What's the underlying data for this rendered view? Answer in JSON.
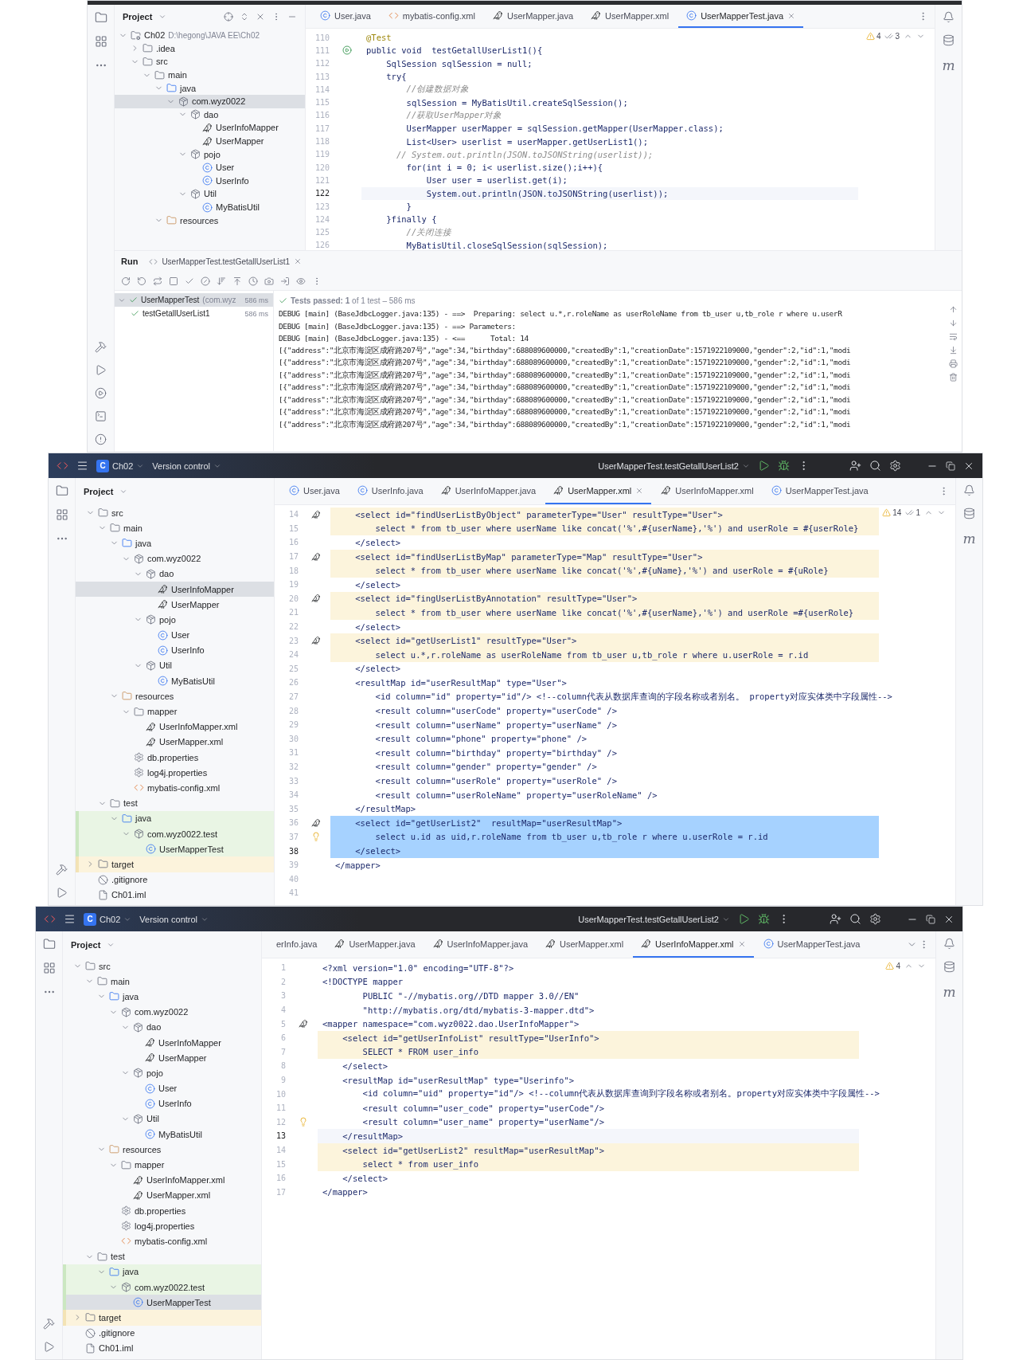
{
  "panels": [
    {
      "kind": "test-run",
      "tree_header": "Project",
      "tree": [
        {
          "label": "Ch02",
          "path": "D:\\hegong\\JAVA EE\\Ch02",
          "kind": "module",
          "expanded": true,
          "selected": false,
          "children": [
            {
              "label": ".idea",
              "kind": "folder",
              "expanded": false,
              "selected": false
            },
            {
              "label": "src",
              "kind": "folder",
              "expanded": true,
              "selected": false,
              "children": [
                {
                  "label": "main",
                  "kind": "folder",
                  "expanded": true,
                  "selected": false,
                  "children": [
                    {
                      "label": "java",
                      "kind": "source",
                      "expanded": true,
                      "selected": false,
                      "children": [
                        {
                          "label": "com.wyz0022",
                          "kind": "package",
                          "expanded": true,
                          "selected": true,
                          "children": [
                            {
                              "label": "dao",
                              "kind": "package",
                              "expanded": true,
                              "selected": false,
                              "children": [
                                {
                                  "label": "UserInfoMapper",
                                  "kind": "mapper",
                                  "selected": false
                                },
                                {
                                  "label": "UserMapper",
                                  "kind": "mapper",
                                  "selected": false
                                }
                              ]
                            },
                            {
                              "label": "pojo",
                              "kind": "package",
                              "expanded": true,
                              "selected": false,
                              "children": [
                                {
                                  "label": "User",
                                  "kind": "class",
                                  "selected": false
                                },
                                {
                                  "label": "UserInfo",
                                  "kind": "class",
                                  "selected": false
                                }
                              ]
                            },
                            {
                              "label": "Util",
                              "kind": "package",
                              "expanded": true,
                              "selected": false,
                              "children": [
                                {
                                  "label": "MyBatisUtil",
                                  "kind": "class",
                                  "selected": false
                                }
                              ]
                            }
                          ]
                        }
                      ]
                    },
                    {
                      "label": "resources",
                      "kind": "resources",
                      "expanded": true,
                      "selected": false
                    }
                  ]
                }
              ]
            }
          ]
        }
      ],
      "tabs": [
        {
          "label": "User.java",
          "kind": "class",
          "selected": false
        },
        {
          "label": "mybatis-config.xml",
          "kind": "xml",
          "selected": false
        },
        {
          "label": "UserMapper.java",
          "kind": "mapper",
          "selected": false
        },
        {
          "label": "UserMapper.xml",
          "kind": "mapper",
          "selected": false
        },
        {
          "label": "UserMapperTest.java",
          "kind": "class",
          "selected": true
        }
      ],
      "inspection": {
        "warnings": "4",
        "checks": "3"
      },
      "code": [
        {
          "n": "110",
          "text": "@Test",
          "kind": "annotation"
        },
        {
          "n": "111",
          "text": "public void  testGetallUserList1(){",
          "kind": "code",
          "gutter": {
            "kind": "run"
          }
        },
        {
          "n": "112",
          "text": "    SqlSession sqlSession = null;",
          "kind": "code"
        },
        {
          "n": "113",
          "text": "    try{",
          "kind": "code"
        },
        {
          "n": "114",
          "text": "        //创建数据对象",
          "kind": "comment"
        },
        {
          "n": "115",
          "text": "        sqlSession = MyBatisUtil.createSqlSession();",
          "kind": "code"
        },
        {
          "n": "116",
          "text": "        //获取UserMapper对象",
          "kind": "comment"
        },
        {
          "n": "117",
          "text": "        UserMapper userMapper = sqlSession.getMapper(UserMapper.class);",
          "kind": "code"
        },
        {
          "n": "118",
          "text": "        List<User> userlist = userMapper.getUserList1();",
          "kind": "code"
        },
        {
          "n": "119",
          "text": "      // System.out.println(JSON.toJSONString(userlist));",
          "kind": "comment"
        },
        {
          "n": "120",
          "text": "        for(int i = 0; i< userlist.size();i++){",
          "kind": "code"
        },
        {
          "n": "121",
          "text": "            User user = userlist.get(i);",
          "kind": "code"
        },
        {
          "n": "122",
          "text": "            System.out.println(JSON.toJSONString(userlist));",
          "kind": "code",
          "current": true
        },
        {
          "n": "123",
          "text": "        }",
          "kind": "code"
        },
        {
          "n": "124",
          "text": "    }finally {",
          "kind": "code"
        },
        {
          "n": "125",
          "text": "        //关闭连接",
          "kind": "comment"
        },
        {
          "n": "126",
          "text": "        MyBatisUtil.closeSqlSession(sqlSession);",
          "kind": "code"
        }
      ],
      "run": {
        "title": "Run",
        "tab": "UserMapperTest.testGetallUserList1",
        "tests": [
          {
            "label": "UserMapperTest",
            "detail": "(com.wyz",
            "time": "586 ms",
            "passed": true,
            "expanded": true
          },
          {
            "label": "testGetallUserList1",
            "time": "586 ms",
            "passed": true
          }
        ],
        "status": "**Tests passed: 1** of 1 test – 586 ms",
        "output": [
          "DEBUG [main] (BaseJdbcLogger.java:135) - ==>  Preparing: select u.*,r.roleName as userRoleName from tb_user u,tb_role r where u.userR",
          "DEBUG [main] (BaseJdbcLogger.java:135) - ==> Parameters: ",
          "DEBUG [main] (BaseJdbcLogger.java:135) - <==      Total: 14",
          "[{\"address\":\"北京市海淀区成府路207号\",\"age\":34,\"birthday\":688089600000,\"createdBy\":1,\"creationDate\":1571922109000,\"gender\":2,\"id\":1,\"modi",
          "[{\"address\":\"北京市海淀区成府路207号\",\"age\":34,\"birthday\":688089600000,\"createdBy\":1,\"creationDate\":1571922109000,\"gender\":2,\"id\":1,\"modi",
          "[{\"address\":\"北京市海淀区成府路207号\",\"age\":34,\"birthday\":688089600000,\"createdBy\":1,\"creationDate\":1571922109000,\"gender\":2,\"id\":1,\"modi",
          "[{\"address\":\"北京市海淀区成府路207号\",\"age\":34,\"birthday\":688089600000,\"createdBy\":1,\"creationDate\":1571922109000,\"gender\":2,\"id\":1,\"modi",
          "[{\"address\":\"北京市海淀区成府路207号\",\"age\":34,\"birthday\":688089600000,\"createdBy\":1,\"creationDate\":1571922109000,\"gender\":2,\"id\":1,\"modi",
          "[{\"address\":\"北京市海淀区成府路207号\",\"age\":34,\"birthday\":688089600000,\"createdBy\":1,\"creationDate\":1571922109000,\"gender\":2,\"id\":1,\"modi",
          "[{\"address\":\"北京市海淀区成府路207号\",\"age\":34,\"birthday\":688089600000,\"createdBy\":1,\"creationDate\":1571922109000,\"gender\":2,\"id\":1,\"modi"
        ]
      },
      "right_stripe_glyph": "m"
    },
    {
      "kind": "editor",
      "title_bar": {
        "project_badge": "C",
        "project": "Ch02",
        "vcs": "Version control",
        "run_config": "UserMapperTest.testGetallUserList2"
      },
      "tree_header": "Project",
      "tree": [
        {
          "label": "src",
          "kind": "folder",
          "expanded": true,
          "selected": false,
          "children": [
            {
              "label": "main",
              "kind": "folder",
              "expanded": true,
              "selected": false,
              "children": [
                {
                  "label": "java",
                  "kind": "source",
                  "expanded": true,
                  "selected": false,
                  "children": [
                    {
                      "label": "com.wyz0022",
                      "kind": "package",
                      "expanded": true,
                      "selected": false,
                      "children": [
                        {
                          "label": "dao",
                          "kind": "package",
                          "expanded": true,
                          "selected": false,
                          "children": [
                            {
                              "label": "UserInfoMapper",
                              "kind": "mapper",
                              "selected": true
                            },
                            {
                              "label": "UserMapper",
                              "kind": "mapper",
                              "selected": false
                            }
                          ]
                        },
                        {
                          "label": "pojo",
                          "kind": "package",
                          "expanded": true,
                          "selected": false,
                          "children": [
                            {
                              "label": "User",
                              "kind": "class",
                              "selected": false
                            },
                            {
                              "label": "UserInfo",
                              "kind": "class",
                              "selected": false
                            }
                          ]
                        },
                        {
                          "label": "Util",
                          "kind": "package",
                          "expanded": true,
                          "selected": false,
                          "children": [
                            {
                              "label": "MyBatisUtil",
                              "kind": "class",
                              "selected": false
                            }
                          ]
                        }
                      ]
                    }
                  ]
                },
                {
                  "label": "resources",
                  "kind": "resources",
                  "expanded": true,
                  "selected": false,
                  "children": [
                    {
                      "label": "mapper",
                      "kind": "folder",
                      "expanded": true,
                      "selected": false,
                      "children": [
                        {
                          "label": "UserInfoMapper.xml",
                          "kind": "mapper",
                          "selected": false
                        },
                        {
                          "label": "UserMapper.xml",
                          "kind": "mapper",
                          "selected": false
                        }
                      ]
                    },
                    {
                      "label": "db.properties",
                      "kind": "props",
                      "selected": false
                    },
                    {
                      "label": "log4j.properties",
                      "kind": "props",
                      "selected": false
                    },
                    {
                      "label": "mybatis-config.xml",
                      "kind": "xml",
                      "selected": false
                    }
                  ]
                }
              ]
            },
            {
              "label": "test",
              "kind": "folder",
              "expanded": true,
              "selected": false,
              "children": [
                {
                  "label": "java",
                  "kind": "source",
                  "expanded": true,
                  "selected": false,
                  "in_tests": true,
                  "children": [
                    {
                      "label": "com.wyz0022.test",
                      "kind": "package",
                      "expanded": true,
                      "selected": false,
                      "in_tests": true,
                      "children": [
                        {
                          "label": "UserMapperTest",
                          "kind": "class",
                          "selected": false,
                          "in_tests": true
                        }
                      ]
                    }
                  ]
                }
              ]
            }
          ]
        },
        {
          "label": "target",
          "kind": "folder",
          "expanded": false,
          "selected": false,
          "excluded": true
        },
        {
          "label": ".gitignore",
          "kind": "ignore",
          "selected": false
        },
        {
          "label": "Ch01.iml",
          "kind": "iml",
          "selected": false
        }
      ],
      "tabs": [
        {
          "label": "User.java",
          "kind": "class",
          "selected": false
        },
        {
          "label": "UserInfo.java",
          "kind": "class",
          "selected": false
        },
        {
          "label": "UserInfoMapper.java",
          "kind": "mapper",
          "selected": false
        },
        {
          "label": "UserMapper.xml",
          "kind": "mapper",
          "selected": true
        },
        {
          "label": "UserInfoMapper.xml",
          "kind": "mapper",
          "selected": false
        },
        {
          "label": "UserMapperTest.java",
          "kind": "class",
          "selected": false
        }
      ],
      "inspection": {
        "warnings": "14",
        "checks": "1"
      },
      "code": [
        {
          "n": "14",
          "text": "    <select id=\"findUserListByObject\" parameterType=\"User\" resultType=\"User\">",
          "kind": "code",
          "gutter": {
            "kind": "mapper"
          },
          "highlighted": true
        },
        {
          "n": "15",
          "text": "        select * from tb_user where userName like concat('%',#{userName},'%') and userRole = #{userRole}",
          "kind": "code",
          "highlighted": true
        },
        {
          "n": "16",
          "text": "    </select>",
          "kind": "code"
        },
        {
          "n": "17",
          "text": "    <select id=\"findUserListByMap\" parameterType=\"Map\" resultType=\"User\">",
          "kind": "code",
          "gutter": {
            "kind": "mapper"
          },
          "highlighted": true
        },
        {
          "n": "18",
          "text": "        select * from tb_user where userName like concat('%',#{uName},'%') and userRole = #{uRole}",
          "kind": "code",
          "highlighted": true
        },
        {
          "n": "19",
          "text": "    </select>",
          "kind": "code"
        },
        {
          "n": "20",
          "text": "    <select id=\"fingUserListByAnnotation\" resultType=\"User\">",
          "kind": "code",
          "gutter": {
            "kind": "mapper"
          },
          "highlighted": true
        },
        {
          "n": "21",
          "text": "        select * from tb_user where userName like concat('%',#{userName},'%') and userRole =#{userRole}",
          "kind": "code",
          "highlighted": true
        },
        {
          "n": "22",
          "text": "    </select>",
          "kind": "code"
        },
        {
          "n": "23",
          "text": "    <select id=\"getUserList1\" resultType=\"User\">",
          "kind": "code",
          "gutter": {
            "kind": "mapper"
          },
          "highlighted": true
        },
        {
          "n": "24",
          "text": "        select u.*,r.roleName as userRoleName from tb_user u,tb_role r where u.userRole = r.id",
          "kind": "code",
          "highlighted": true
        },
        {
          "n": "25",
          "text": "    </select>",
          "kind": "code"
        },
        {
          "n": "26",
          "text": "    <resultMap id=\"userResultMap\" type=\"User\">",
          "kind": "code"
        },
        {
          "n": "27",
          "text": "        <id column=\"id\" property=\"id\"/> <!--column代表从数据库查询的字段名称或者别名。 property对应实体类中字段属性-->",
          "kind": "code"
        },
        {
          "n": "28",
          "text": "        <result column=\"userCode\" property=\"userCode\" />",
          "kind": "code"
        },
        {
          "n": "29",
          "text": "        <result column=\"userName\" property=\"userName\" />",
          "kind": "code"
        },
        {
          "n": "30",
          "text": "        <result column=\"phone\" property=\"phone\" />",
          "kind": "code"
        },
        {
          "n": "31",
          "text": "        <result column=\"birthday\" property=\"birthday\" />",
          "kind": "code"
        },
        {
          "n": "32",
          "text": "        <result column=\"gender\" property=\"gender\" />",
          "kind": "code"
        },
        {
          "n": "33",
          "text": "        <result column=\"userRole\" property=\"userRole\" />",
          "kind": "code"
        },
        {
          "n": "34",
          "text": "        <result column=\"userRoleName\" property=\"userRoleName\" />",
          "kind": "code"
        },
        {
          "n": "35",
          "text": "    </resultMap>",
          "kind": "code"
        },
        {
          "n": "36",
          "text": "    <select id=\"getUserList2\"  resultMap=\"userResultMap\">",
          "kind": "code",
          "gutter": {
            "kind": "mapper"
          },
          "selected": true
        },
        {
          "n": "37",
          "text": "        select u.id as uid,r.roleName from tb_user u,tb_role r where u.userRole = r.id",
          "kind": "code",
          "gutter": {
            "kind": "bulb"
          },
          "selected": true
        },
        {
          "n": "38",
          "text": "    </select>",
          "kind": "code",
          "selected": true,
          "current": true
        },
        {
          "n": "39",
          "text": "</mapper>",
          "kind": "code"
        },
        {
          "n": "40",
          "kind": "code"
        },
        {
          "n": "41",
          "kind": "code"
        }
      ],
      "right_stripe_glyph": "m"
    },
    {
      "kind": "editor",
      "title_bar": {
        "project_badge": "C",
        "project": "Ch02",
        "vcs": "Version control",
        "run_config": "UserMapperTest.testGetallUserList2"
      },
      "tree_header": "Project",
      "tree": [
        {
          "label": "src",
          "kind": "folder",
          "expanded": true,
          "selected": false,
          "children": [
            {
              "label": "main",
              "kind": "folder",
              "expanded": true,
              "selected": false,
              "children": [
                {
                  "label": "java",
                  "kind": "source",
                  "expanded": true,
                  "selected": false,
                  "children": [
                    {
                      "label": "com.wyz0022",
                      "kind": "package",
                      "expanded": true,
                      "selected": false,
                      "children": [
                        {
                          "label": "dao",
                          "kind": "package",
                          "expanded": true,
                          "selected": false,
                          "children": [
                            {
                              "label": "UserInfoMapper",
                              "kind": "mapper",
                              "selected": false
                            },
                            {
                              "label": "UserMapper",
                              "kind": "mapper",
                              "selected": false
                            }
                          ]
                        },
                        {
                          "label": "pojo",
                          "kind": "package",
                          "expanded": true,
                          "selected": false,
                          "children": [
                            {
                              "label": "User",
                              "kind": "class",
                              "selected": false
                            },
                            {
                              "label": "UserInfo",
                              "kind": "class",
                              "selected": false
                            }
                          ]
                        },
                        {
                          "label": "Util",
                          "kind": "package",
                          "expanded": true,
                          "selected": false,
                          "children": [
                            {
                              "label": "MyBatisUtil",
                              "kind": "class",
                              "selected": false
                            }
                          ]
                        }
                      ]
                    }
                  ]
                },
                {
                  "label": "resources",
                  "kind": "resources",
                  "expanded": true,
                  "selected": false,
                  "children": [
                    {
                      "label": "mapper",
                      "kind": "folder",
                      "expanded": true,
                      "selected": false,
                      "children": [
                        {
                          "label": "UserInfoMapper.xml",
                          "kind": "mapper",
                          "selected": false
                        },
                        {
                          "label": "UserMapper.xml",
                          "kind": "mapper",
                          "selected": false
                        }
                      ]
                    },
                    {
                      "label": "db.properties",
                      "kind": "props",
                      "selected": false
                    },
                    {
                      "label": "log4j.properties",
                      "kind": "props",
                      "selected": false
                    },
                    {
                      "label": "mybatis-config.xml",
                      "kind": "xml",
                      "selected": false
                    }
                  ]
                }
              ]
            },
            {
              "label": "test",
              "kind": "folder",
              "expanded": true,
              "selected": false,
              "children": [
                {
                  "label": "java",
                  "kind": "source",
                  "expanded": true,
                  "selected": false,
                  "in_tests": true,
                  "children": [
                    {
                      "label": "com.wyz0022.test",
                      "kind": "package",
                      "expanded": true,
                      "selected": false,
                      "in_tests": true,
                      "children": [
                        {
                          "label": "UserMapperTest",
                          "kind": "class",
                          "selected": true,
                          "in_tests": true
                        }
                      ]
                    }
                  ]
                }
              ]
            }
          ]
        },
        {
          "label": "target",
          "kind": "folder",
          "expanded": false,
          "selected": false,
          "excluded": true
        },
        {
          "label": ".gitignore",
          "kind": "ignore",
          "selected": false
        },
        {
          "label": "Ch01.iml",
          "kind": "iml",
          "selected": false
        }
      ],
      "tabs": [
        {
          "label": "erInfo.java",
          "kind": "none",
          "selected": false
        },
        {
          "label": "UserMapper.java",
          "kind": "mapper",
          "selected": false
        },
        {
          "label": "UserInfoMapper.java",
          "kind": "mapper",
          "selected": false
        },
        {
          "label": "UserMapper.xml",
          "kind": "mapper",
          "selected": false
        },
        {
          "label": "UserInfoMapper.xml",
          "kind": "mapper",
          "selected": true
        },
        {
          "label": "UserMapperTest.java",
          "kind": "class",
          "selected": false
        }
      ],
      "tab_overflow": true,
      "inspection": {
        "warnings": "4"
      },
      "code": [
        {
          "n": "1",
          "text": "<?xml version=\"1.0\" encoding=\"UTF-8\"?>",
          "kind": "code"
        },
        {
          "n": "2",
          "text": "<!DOCTYPE mapper",
          "kind": "code"
        },
        {
          "n": "3",
          "text": "        PUBLIC \"-//mybatis.org//DTD mapper 3.0//EN\"",
          "kind": "code"
        },
        {
          "n": "4",
          "text": "        \"http://mybatis.org/dtd/mybatis-3-mapper.dtd\">",
          "kind": "code"
        },
        {
          "n": "5",
          "text": "<mapper namespace=\"com.wyz0022.dao.UserInfoMapper\">",
          "kind": "code",
          "gutter": {
            "kind": "mapper"
          }
        },
        {
          "n": "6",
          "text": "    <select id=\"getUserInfoList\" resultType=\"UserInfo\">",
          "kind": "code",
          "highlighted": true
        },
        {
          "n": "7",
          "text": "        SELECT * FROM user_info",
          "kind": "code",
          "highlighted": true
        },
        {
          "n": "8",
          "text": "    </select>",
          "kind": "code"
        },
        {
          "n": "9",
          "text": "    <resultMap id=\"userResultMap\" type=\"Userinfo\">",
          "kind": "code"
        },
        {
          "n": "10",
          "text": "        <id column=\"uid\" property=\"id\"/> <!--column代表从数据库查询到字段名称或者别名。property对应实体类中字段属性-->",
          "kind": "code"
        },
        {
          "n": "11",
          "text": "        <result column=\"user_code\" property=\"userCode\"/>",
          "kind": "code"
        },
        {
          "n": "12",
          "text": "        <result column=\"user_name\" property=\"userName\"/>",
          "kind": "code",
          "gutter": {
            "kind": "bulb"
          }
        },
        {
          "n": "13",
          "text": "    </resultMap>",
          "kind": "code",
          "current": true
        },
        {
          "n": "14",
          "text": "    <select id=\"getUserList2\" resultMap=\"userResultMap\">",
          "kind": "code",
          "highlighted": true
        },
        {
          "n": "15",
          "text": "        select * from user_info",
          "kind": "code",
          "highlighted": true
        },
        {
          "n": "16",
          "text": "    </select>",
          "kind": "code"
        },
        {
          "n": "17",
          "text": "</mapper>",
          "kind": "code"
        }
      ],
      "right_stripe_glyph": "m"
    }
  ]
}
